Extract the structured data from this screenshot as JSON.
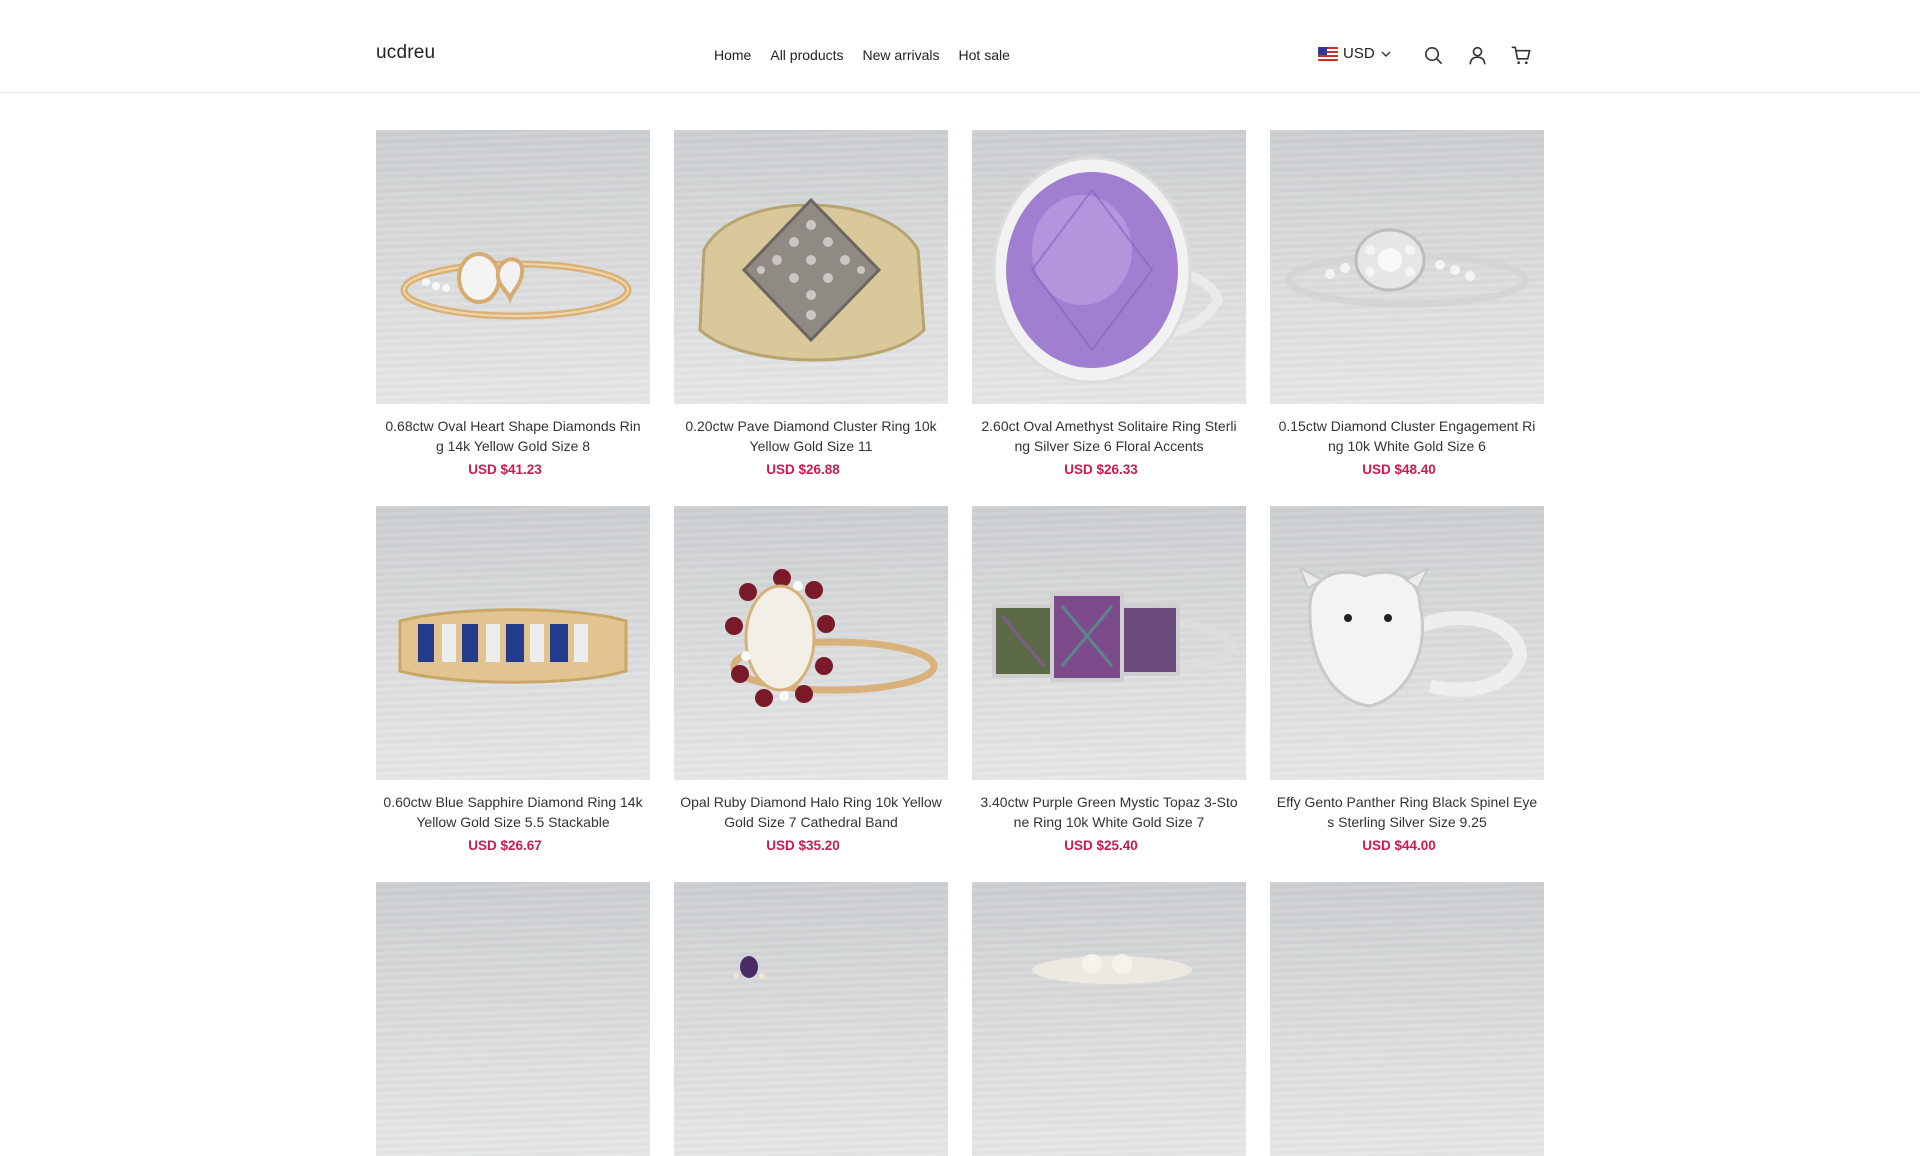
{
  "header": {
    "logo": "ucdreu",
    "nav": [
      "Home",
      "All products",
      "New arrivals",
      "Hot sale"
    ],
    "currency": "USD",
    "icons": [
      "search-icon",
      "account-icon",
      "cart-icon"
    ]
  },
  "colors": {
    "price": "#c81c4f",
    "border": "#ececec"
  },
  "products": [
    {
      "title": "0.68ctw Oval Heart Shape Diamonds Ring 14k Yellow Gold Size 8",
      "price": "USD $41.23"
    },
    {
      "title": "0.20ctw Pave Diamond Cluster Ring 10k Yellow Gold Size 11",
      "price": "USD $26.88"
    },
    {
      "title": "2.60ct Oval Amethyst Solitaire Ring Sterling Silver Size 6 Floral Accents",
      "price": "USD $26.33"
    },
    {
      "title": "0.15ctw Diamond Cluster Engagement Ring 10k White Gold Size 6",
      "price": "USD $48.40"
    },
    {
      "title": "0.60ctw Blue Sapphire Diamond Ring 14k Yellow Gold Size 5.5 Stackable",
      "price": "USD $26.67"
    },
    {
      "title": "Opal Ruby Diamond Halo Ring 10k Yellow Gold Size 7 Cathedral Band",
      "price": "USD $35.20"
    },
    {
      "title": "3.40ctw Purple Green Mystic Topaz 3-Stone Ring 10k White Gold Size 7",
      "price": "USD $25.40"
    },
    {
      "title": "Effy Gento Panther Ring Black Spinel Eyes Sterling Silver Size 9.25",
      "price": "USD $44.00"
    }
  ]
}
